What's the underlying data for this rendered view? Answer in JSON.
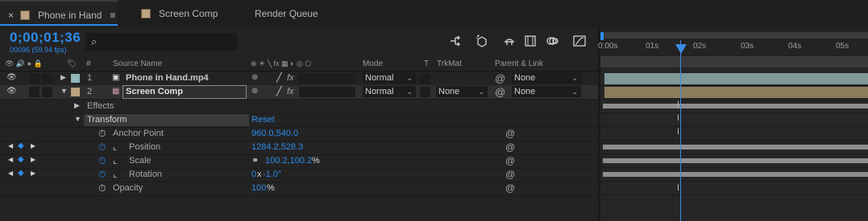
{
  "tabs": [
    {
      "label": "Phone in Hand",
      "active": true,
      "close": "×",
      "menu": "≡",
      "swatch": "#bca27e"
    },
    {
      "label": "Screen Comp",
      "active": false,
      "swatch": "#bca27e"
    },
    {
      "label": "Render Queue",
      "active": false
    }
  ],
  "header": {
    "timecode": "0;00;01;36",
    "frame_info": "00096 (59.94 fps)",
    "search_icon": "⌕",
    "search_placeholder": ""
  },
  "toolbar_icons": [
    "comp-mini-flowchart-icon",
    "draft-3d-icon",
    "shy-layers-icon",
    "frame-blending-icon",
    "motion-blur-icon",
    "graph-editor-icon"
  ],
  "columns": {
    "av": "👁 🔊 ● 🔒",
    "label_icon": "🏷",
    "num": "#",
    "source_name": "Source Name",
    "switches": "⊕ ☀ ╲ fx ▦ ◐ ◎ ⬡",
    "mode": "Mode",
    "t": "T",
    "trkmat": "TrkMat",
    "parent": "Parent & Link"
  },
  "layers": [
    {
      "num": "1",
      "name": "Phone in Hand.mp4",
      "mode": "Normal",
      "trkmat": "",
      "parent": "None",
      "color": "#8fb7b9"
    },
    {
      "num": "2",
      "name": "Screen Comp",
      "mode": "Normal",
      "trkmat": "None",
      "parent": "None",
      "color": "#bca27e"
    }
  ],
  "groups": {
    "effects": "Effects",
    "transform": "Transform",
    "reset": "Reset"
  },
  "properties": [
    {
      "name": "Anchor Point",
      "value_a": "960.0,540.0",
      "value_b": "",
      "unit": ""
    },
    {
      "name": "Position",
      "value_a": "1284.2,528.3",
      "value_b": "",
      "unit": ""
    },
    {
      "name": "Scale",
      "value_a": "100.2,100.2",
      "value_b": "",
      "unit": "%"
    },
    {
      "name": "Rotation",
      "value_a": "0",
      "value_b": "x",
      "unit": "-1.0°"
    },
    {
      "name": "Opacity",
      "value_a": "100",
      "value_b": "",
      "unit": "%"
    }
  ],
  "ruler": {
    "labels": [
      "0:00s",
      "01s",
      "02s",
      "03s",
      "04s",
      "05s"
    ]
  },
  "colors": {
    "accent": "#2d8ceb",
    "layer1_bar": "#7f9898",
    "layer2_bar": "#8b7d5c"
  }
}
